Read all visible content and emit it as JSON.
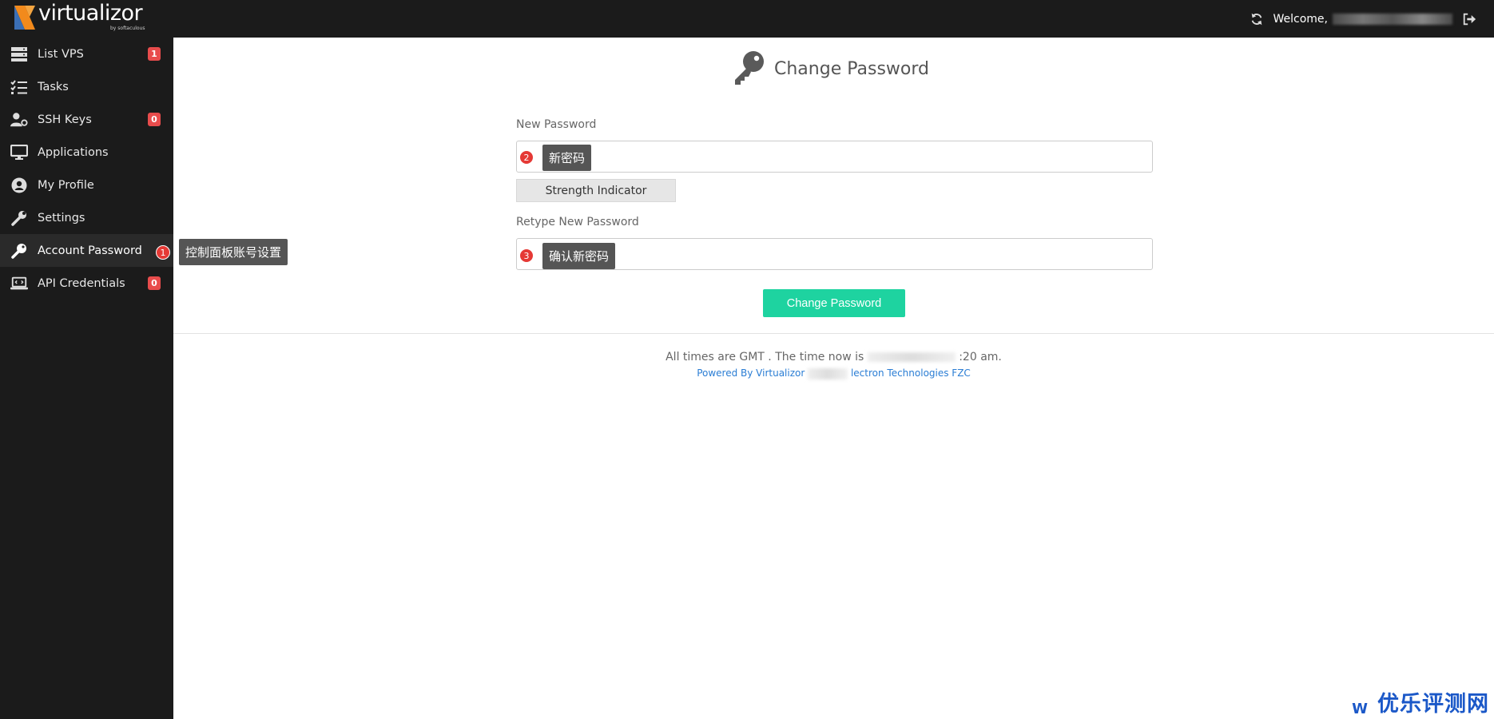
{
  "header": {
    "logo_text": "virtualizor",
    "logo_sub": "by softaculous",
    "welcome": "Welcome,"
  },
  "sidebar": {
    "items": [
      {
        "label": "List VPS",
        "icon": "server-icon",
        "badge": "1"
      },
      {
        "label": "Tasks",
        "icon": "tasks-icon"
      },
      {
        "label": "SSH Keys",
        "icon": "user-key-icon",
        "badge": "0"
      },
      {
        "label": "Applications",
        "icon": "monitor-icon"
      },
      {
        "label": "My Profile",
        "icon": "user-circle-icon"
      },
      {
        "label": "Settings",
        "icon": "wrench-icon"
      },
      {
        "label": "Account Password",
        "icon": "key-icon",
        "active": true
      },
      {
        "label": "API Credentials",
        "icon": "laptop-code-icon",
        "badge": "0"
      }
    ]
  },
  "callouts": {
    "c1": {
      "num": "1",
      "text": "控制面板账号设置"
    },
    "c2": {
      "num": "2",
      "text": "新密码"
    },
    "c3": {
      "num": "3",
      "text": "确认新密码"
    }
  },
  "main": {
    "title": "Change Password",
    "new_password_label": "New Password",
    "strength_label": "Strength Indicator",
    "retype_label": "Retype New Password",
    "submit_label": "Change Password"
  },
  "footer": {
    "time_prefix": "All times are GMT . The time now is",
    "time_suffix": ":20 am.",
    "powered_prefix": "Powered By Virtualizor",
    "powered_suffix": "lectron Technologies FZC"
  },
  "watermark": {
    "w": "W",
    "text": "优乐评测网"
  },
  "colors": {
    "sidebar_bg": "#1b1b1b",
    "badge": "#e84c4c",
    "button": "#1ed3a0",
    "callout": "#555555",
    "callout_num": "#e53935",
    "link": "#2a7dd4",
    "watermark": "#1b58c8"
  }
}
